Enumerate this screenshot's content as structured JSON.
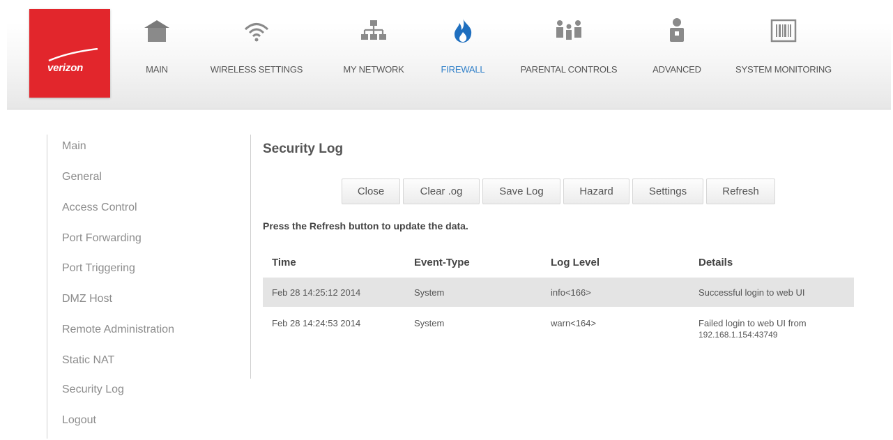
{
  "brand": {
    "name": "verizon",
    "color": "#e2262c"
  },
  "nav": {
    "accent": "#2f7fc8",
    "items": [
      {
        "label": "MAIN",
        "icon": "home-icon"
      },
      {
        "label": "WIRELESS SETTINGS",
        "icon": "wifi-icon"
      },
      {
        "label": "MY NETWORK",
        "icon": "network-icon"
      },
      {
        "label": "FIREWALL",
        "icon": "flame-icon",
        "active": true
      },
      {
        "label": "PARENTAL CONTROLS",
        "icon": "family-icon"
      },
      {
        "label": "ADVANCED",
        "icon": "person-icon"
      },
      {
        "label": "SYSTEM MONITORING",
        "icon": "barcode-icon"
      }
    ]
  },
  "sidebar": {
    "items": [
      {
        "label": "Main"
      },
      {
        "label": "General"
      },
      {
        "label": "Access Control"
      },
      {
        "label": "Port Forwarding"
      },
      {
        "label": "Port Triggering"
      },
      {
        "label": "DMZ Host"
      },
      {
        "label": "Remote Administration"
      },
      {
        "label": "Static NAT"
      },
      {
        "label": "Security Log"
      },
      {
        "label": "Logout"
      }
    ]
  },
  "main": {
    "title": "Security Log",
    "buttons": [
      {
        "label": "Close"
      },
      {
        "label": "Clear .og"
      },
      {
        "label": "Save Log"
      },
      {
        "label": "Hazard"
      },
      {
        "label": "Settings"
      },
      {
        "label": "Refresh"
      }
    ],
    "hint": "Press the Refresh button to update the data.",
    "table": {
      "columns": [
        "Time",
        "Event-Type",
        "Log Level",
        "Details"
      ],
      "rows": [
        [
          "Feb 28 14:25:12 2014",
          "System",
          "info<166>",
          "Successful login to web UI"
        ],
        [
          "Feb 28 14:24:53 2014",
          "System",
          "warn<164>",
          "Failed login to web UI from",
          "192.168.1.154:43749"
        ]
      ]
    }
  }
}
